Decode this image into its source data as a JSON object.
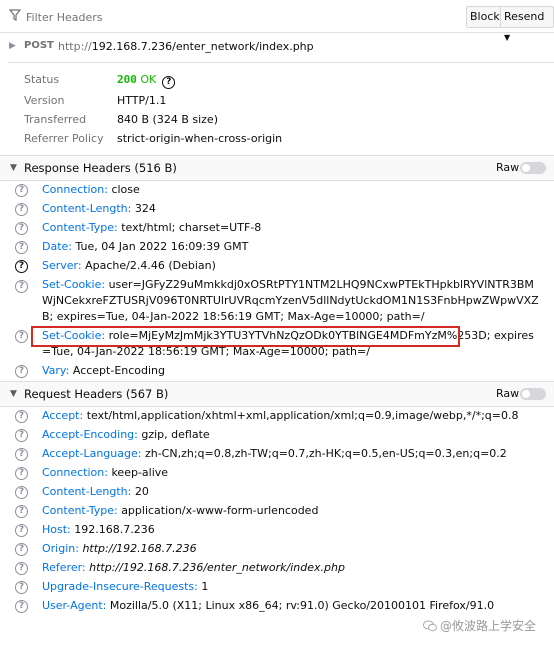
{
  "filter": {
    "placeholder": "Filter Headers",
    "block_label": "Block",
    "resend_label": "Resend"
  },
  "request": {
    "method": "POST",
    "url_scheme": "http://",
    "url_rest": "192.168.7.236/enter_network/index.php"
  },
  "summary": {
    "status_label": "Status",
    "status_code": "200",
    "status_text": "OK",
    "version_label": "Version",
    "version_value": "HTTP/1.1",
    "transferred_label": "Transferred",
    "transferred_value": "840 B (324 B size)",
    "referrer_label": "Referrer Policy",
    "referrer_value": "strict-origin-when-cross-origin"
  },
  "response_headers": {
    "title": "Response Headers (516 B)",
    "raw_label": "Raw",
    "items": [
      {
        "name": "Connection:",
        "value": "close"
      },
      {
        "name": "Content-Length:",
        "value": "324"
      },
      {
        "name": "Content-Type:",
        "value": "text/html; charset=UTF-8"
      },
      {
        "name": "Date:",
        "value": "Tue, 04 Jan 2022 16:09:39 GMT"
      },
      {
        "name": "Server:",
        "value": "Apache/2.4.46 (Debian)"
      },
      {
        "name": "Set-Cookie:",
        "value": "user=JGFyZ29uMmkkdj0xOSRtPTY1NTM2LHQ9NCxwPTEkTHpkblRYVlNTR3BMWjNCekxreFZTUSRjV096T0NRTUlrUVRqcmYzenV5dllNdytUckdOM1N1S3FnbHpwZWpwVXZB; expires=Tue, 04-Jan-2022 18:56:19 GMT; Max-Age=10000; path=/"
      },
      {
        "name": "Set-Cookie:",
        "value": "role=MjEyMzJmMjk3YTU3YTVhNzQzODk0YTBlNGE4MDFmYzM%253D; expires=Tue, 04-Jan-2022 18:56:19 GMT; Max-Age=10000; path=/"
      },
      {
        "name": "Vary:",
        "value": "Accept-Encoding"
      }
    ]
  },
  "request_headers": {
    "title": "Request Headers (567 B)",
    "raw_label": "Raw",
    "items": [
      {
        "name": "Accept:",
        "value": "text/html,application/xhtml+xml,application/xml;q=0.9,image/webp,*/*;q=0.8"
      },
      {
        "name": "Accept-Encoding:",
        "value": "gzip, deflate"
      },
      {
        "name": "Accept-Language:",
        "value": "zh-CN,zh;q=0.8,zh-TW;q=0.7,zh-HK;q=0.5,en-US;q=0.3,en;q=0.2"
      },
      {
        "name": "Connection:",
        "value": "keep-alive"
      },
      {
        "name": "Content-Length:",
        "value": "20"
      },
      {
        "name": "Content-Type:",
        "value": "application/x-www-form-urlencoded"
      },
      {
        "name": "Host:",
        "value": "192.168.7.236"
      },
      {
        "name": "Origin:",
        "value": "http://192.168.7.236"
      },
      {
        "name": "Referer:",
        "value": "http://192.168.7.236/enter_network/index.php"
      },
      {
        "name": "Upgrade-Insecure-Requests:",
        "value": "1"
      },
      {
        "name": "User-Agent:",
        "value": "Mozilla/5.0 (X11; Linux x86_64; rv:91.0) Gecko/20100101 Firefox/91.0"
      }
    ]
  },
  "watermark": {
    "text": "@攸波路上学安全"
  }
}
